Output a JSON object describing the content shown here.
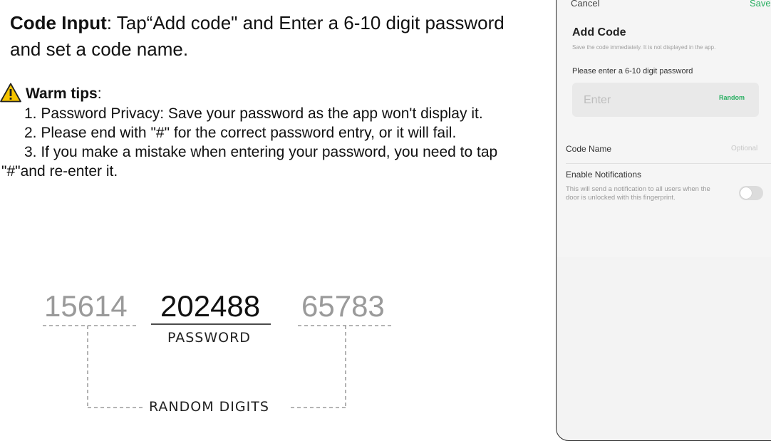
{
  "instructions": {
    "heading_bold": "Code Input",
    "heading_rest": ": Tap“Add code\" and Enter a 6-10 digit password and set a code name.",
    "warm_tips_label": "Warm tips",
    "warm_tips_colon": ":",
    "tips": [
      "1. Password Privacy: Save your password as the app won't display it.",
      "2. Please end with \"#\" for the correct password entry, or it will fail.",
      "3. If you make a mistake when entering your password, you need to tap \"#\"and re-enter it."
    ],
    "icon": "warning-triangle-icon"
  },
  "diagram": {
    "random_left": "15614",
    "password": "202488",
    "random_right": "65783",
    "password_caption": "PASSWORD",
    "random_caption": "RANDOM DIGITS"
  },
  "phone": {
    "cancel": "Cancel",
    "save": "Save",
    "title": "Add Code",
    "subtitle": "Save the code immediately. It is not displayed in the app.",
    "password_label": "Please enter a 6-10 digit password",
    "password_placeholder": "Enter",
    "random_button": "Random",
    "code_name_label": "Code Name",
    "code_name_placeholder": "Optional",
    "notif_title": "Enable Notifications",
    "notif_desc": "This will send a notification to all users when the door is unlocked with this fingerprint.",
    "notif_enabled": false
  },
  "colors": {
    "accent_green": "#27ae60",
    "warning_yellow": "#f5c400",
    "random_digit_gray": "#9a9a9a"
  }
}
